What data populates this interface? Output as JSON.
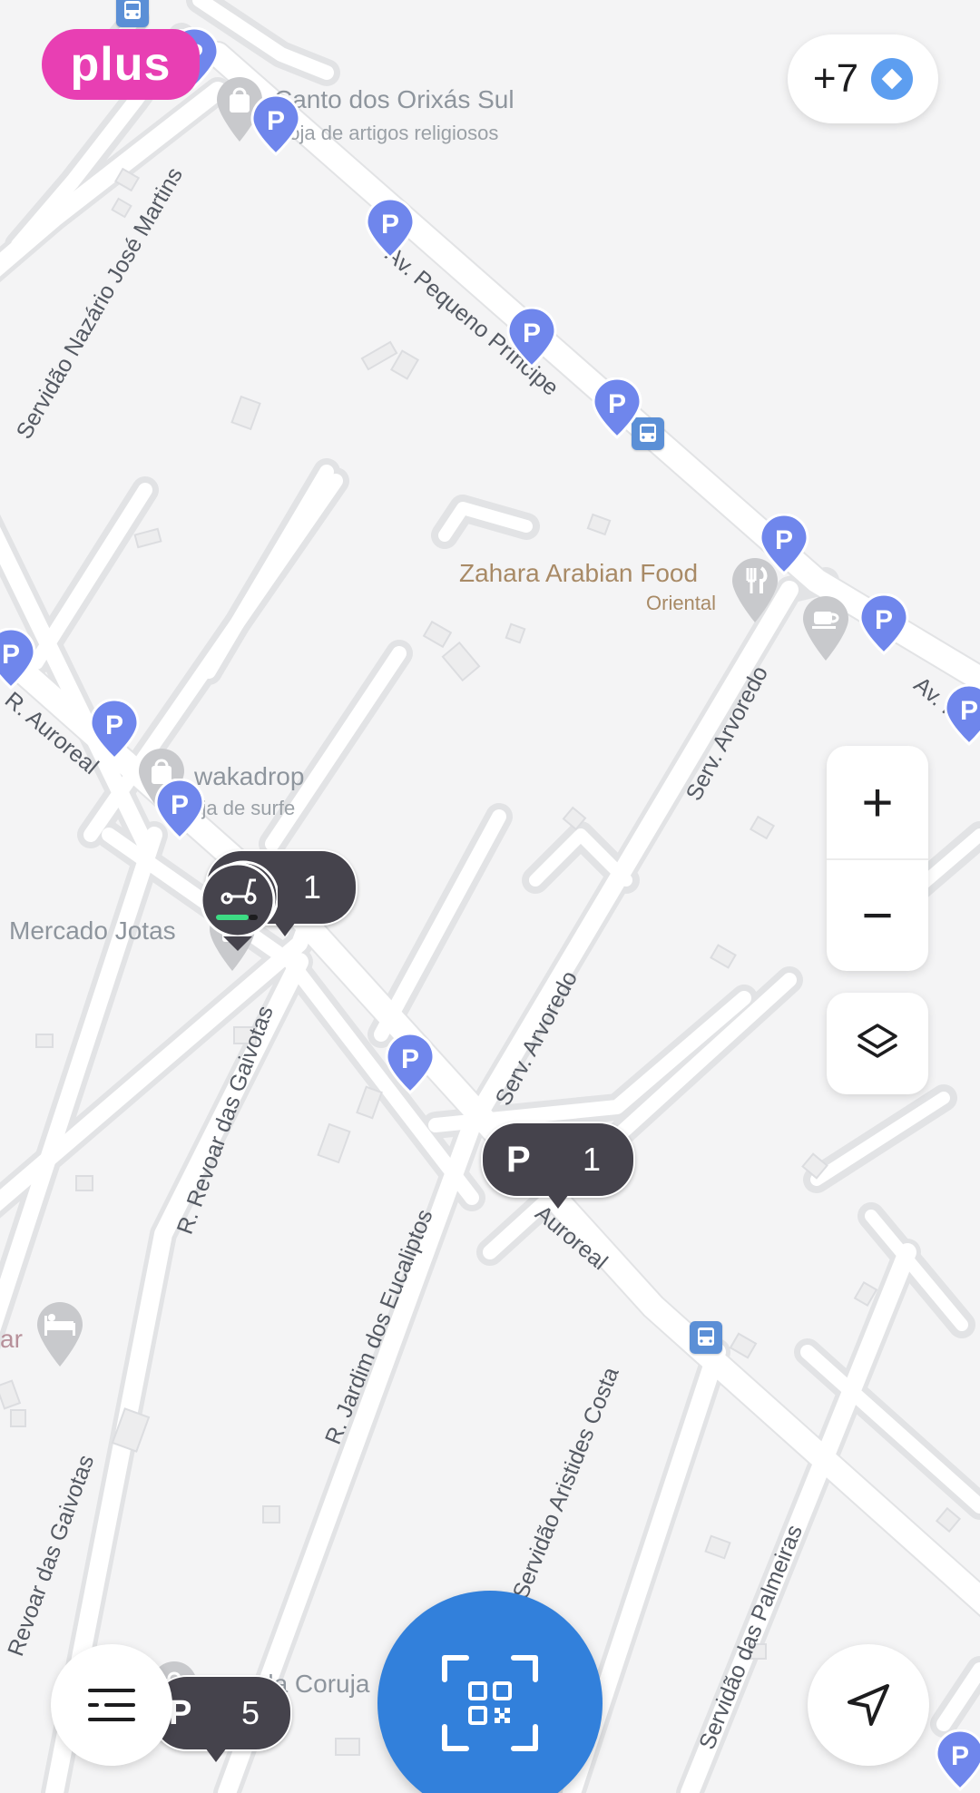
{
  "app": {
    "brand_badge": "plus",
    "hidden_count": "+7"
  },
  "colors": {
    "map_bg": "#f4f4f5",
    "road": "#ffffff",
    "parking_pin": "#6f86ec",
    "cluster_bg": "#45434c",
    "plus_badge": "#e83fb3",
    "scan_button": "#3280db",
    "bus_stop": "#5b8fd6"
  },
  "map": {
    "streets": [
      {
        "name": "Servidão Nazário José Martins"
      },
      {
        "name": "Av. Pequeno Príncipe",
        "shown": "Av. Pequeno Príncipe"
      },
      {
        "name": "R. Auroreal"
      },
      {
        "name": "Serv. Arvoredo"
      },
      {
        "name": "Serv. Arvoredo"
      },
      {
        "name": "R. Revoar das Gaivotas"
      },
      {
        "name": "R. Jardim dos Eucaliptos"
      },
      {
        "name": "Auroreal"
      },
      {
        "name": "Servidão Aristides Costa"
      },
      {
        "name": "Servidão das Palmeiras"
      },
      {
        "name": "Revoar das Gaivotas"
      },
      {
        "name": "Av. Pe"
      }
    ],
    "pois": [
      {
        "name": "Canto dos Orixás Sul",
        "subtitle": "Loja de artigos religiosos",
        "icon": "shopping-bag-icon"
      },
      {
        "name": "Zahara Arabian Food",
        "subtitle": "Oriental",
        "icon": "restaurant-icon"
      },
      {
        "name": "",
        "subtitle": "",
        "icon": "cafe-icon"
      },
      {
        "name": "wakadrop",
        "subtitle": "Loja de surfe",
        "icon": "shopping-bag-icon"
      },
      {
        "name": "Mercado Jotas",
        "subtitle": "",
        "icon": "shopping-bag-icon"
      },
      {
        "name": "ar",
        "subtitle": "",
        "icon": "hotel-icon"
      },
      {
        "name": "da Coruja",
        "subtitle": "",
        "icon": "shopping-bag-icon"
      }
    ],
    "parking_pin_label": "P",
    "clusters": [
      {
        "kind": "scooter",
        "count": "1",
        "icon": "scooter-icon"
      },
      {
        "kind": "parking",
        "label": "P",
        "count": "1"
      },
      {
        "kind": "parking",
        "label": "P",
        "count": "5"
      }
    ]
  },
  "controls": {
    "zoom_in": "+",
    "zoom_out": "−",
    "layers": "layers-icon",
    "scan": "qr-scan-icon",
    "menu": "menu-icon",
    "locate": "navigation-arrow-icon"
  }
}
